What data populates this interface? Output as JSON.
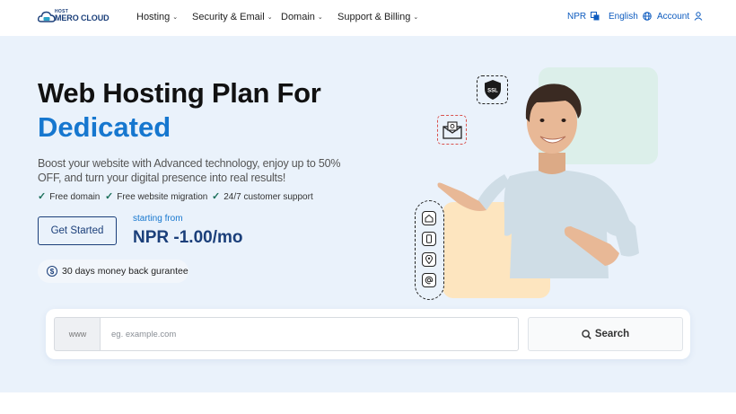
{
  "logo": {
    "tag": "HOST",
    "name": "MERO CLOUD"
  },
  "nav": {
    "items": [
      {
        "label": "Hosting"
      },
      {
        "label": "Security & Email"
      },
      {
        "label": "Domain"
      },
      {
        "label": "Support & Billing"
      }
    ],
    "currency": "NPR",
    "language": "English",
    "account": "Account"
  },
  "hero": {
    "title_line1": "Web Hosting Plan For",
    "title_line2": "Dedicated",
    "description": "Boost your website with Advanced technology, enjoy up to 50% OFF, and turn your digital presence into real results!",
    "features": [
      "Free domain",
      "Free website migration",
      "24/7 customer support"
    ],
    "cta_label": "Get Started",
    "starting_from": "starting from",
    "price": "NPR -1.00/mo",
    "guarantee": "30 days money back gurantee",
    "badge_ssl": "SSL"
  },
  "search": {
    "prefix": "www",
    "placeholder": "eg. example.com",
    "value": "",
    "button_label": "Search"
  },
  "colors": {
    "brand_dark": "#1b3f7a",
    "accent_blue": "#1677cf",
    "hero_bg": "#eaf2fb",
    "check_green": "#1a6f5a"
  },
  "icons": [
    "cloud-logo-icon",
    "chevron-down-icon",
    "translate-icon",
    "globe-icon",
    "user-icon",
    "check-icon",
    "dollar-coin-icon",
    "ssl-shield-icon",
    "mail-icon",
    "home-icon",
    "phone-icon",
    "location-pin-icon",
    "at-sign-icon",
    "search-icon"
  ]
}
